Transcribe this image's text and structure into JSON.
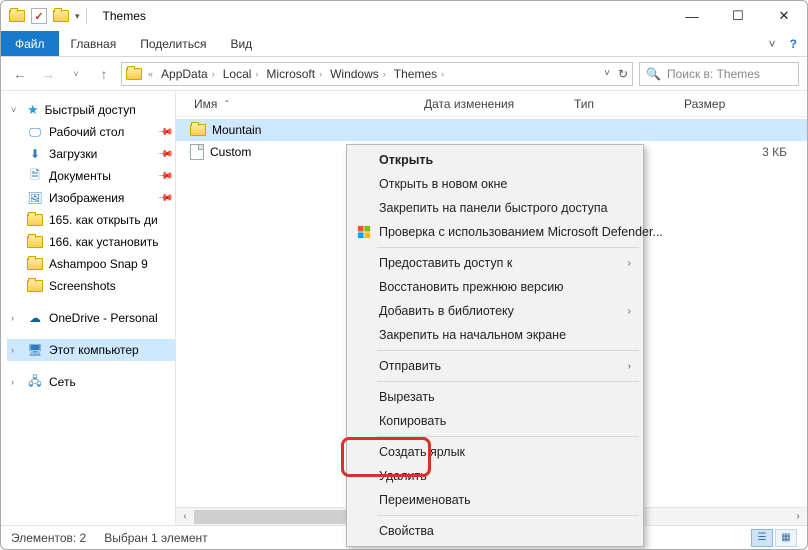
{
  "title": "Themes",
  "ribbon": {
    "file": "Файл",
    "tabs": [
      "Главная",
      "Поделиться",
      "Вид"
    ]
  },
  "breadcrumbs": [
    "AppData",
    "Local",
    "Microsoft",
    "Windows",
    "Themes"
  ],
  "search_placeholder": "Поиск в: Themes",
  "sidebar": {
    "quick_access": "Быстрый доступ",
    "items": [
      {
        "label": "Рабочий стол",
        "pinned": true,
        "icon": "desktop"
      },
      {
        "label": "Загрузки",
        "pinned": true,
        "icon": "download"
      },
      {
        "label": "Документы",
        "pinned": true,
        "icon": "docs"
      },
      {
        "label": "Изображения",
        "pinned": true,
        "icon": "pics"
      },
      {
        "label": "165. как открыть ди",
        "pinned": false,
        "icon": "folder"
      },
      {
        "label": "166. как установить",
        "pinned": false,
        "icon": "folder"
      },
      {
        "label": "Ashampoo Snap 9",
        "pinned": false,
        "icon": "folder"
      },
      {
        "label": "Screenshots",
        "pinned": false,
        "icon": "folder"
      }
    ],
    "onedrive": "OneDrive - Personal",
    "this_pc": "Этот компьютер",
    "network": "Сеть"
  },
  "columns": {
    "name": "Имя",
    "date": "Дата изменения",
    "type": "Тип",
    "size": "Размер"
  },
  "files": [
    {
      "name": "Mountain",
      "date": "",
      "type": "",
      "size": "",
      "icon": "folder",
      "selected": true
    },
    {
      "name": "Custom",
      "date": "",
      "type": "",
      "size": "3 КБ",
      "icon": "doc",
      "selected": false
    }
  ],
  "status": {
    "count": "Элементов: 2",
    "selected": "Выбран 1 элемент"
  },
  "context_menu": {
    "open": "Открыть",
    "open_new": "Открыть в новом окне",
    "pin_qa": "Закрепить на панели быстрого доступа",
    "defender": "Проверка с использованием Microsoft Defender...",
    "give_access": "Предоставить доступ к",
    "restore": "Восстановить прежнюю версию",
    "add_lib": "Добавить в библиотеку",
    "pin_start": "Закрепить на начальном экране",
    "send_to": "Отправить",
    "cut": "Вырезать",
    "copy": "Копировать",
    "shortcut": "Создать ярлык",
    "delete": "Удалить",
    "rename": "Переименовать",
    "properties": "Свойства"
  }
}
